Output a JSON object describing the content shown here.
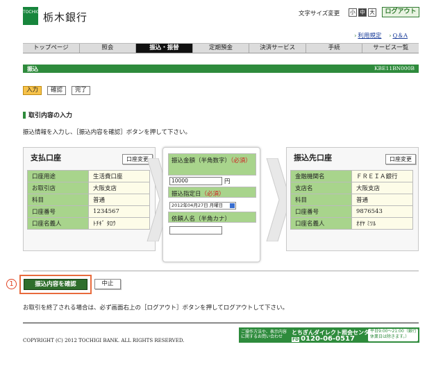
{
  "header": {
    "logo_text": "TOCHIGI",
    "bank_name": "栃木銀行",
    "font_size_label": "文字サイズ変更",
    "font_sizes": [
      "小",
      "中",
      "大"
    ],
    "logout": "ログアウト",
    "links": [
      "利用規定",
      "Q＆A"
    ]
  },
  "nav": [
    "トップページ",
    "照会",
    "振込・振替",
    "定期預金",
    "決済サービス",
    "手続",
    "サービス一覧"
  ],
  "nav_active": 2,
  "title": "振込",
  "title_code": "KBE11BN000B",
  "steps": [
    "入力",
    "確認",
    "完了"
  ],
  "section_title": "取引内容の入力",
  "instruction": "振込情報を入力し、［振込内容を確認］ボタンを押して下さい。",
  "from_account": {
    "title": "支払口座",
    "change_button": "口座変更",
    "rows": [
      {
        "key": "口座用途",
        "value": "生活費口座"
      },
      {
        "key": "お取引店",
        "value": "大阪支店"
      },
      {
        "key": "科目",
        "value": "普通"
      },
      {
        "key": "口座番号",
        "value": "1234567"
      },
      {
        "key": "口座名義人",
        "value": "ﾄﾁｷﾞ ﾀﾛｳ"
      }
    ]
  },
  "transfer_form": {
    "amount_label": "振込金額（半角数字）",
    "required": "（必須）",
    "amount_value": "10000",
    "amount_unit": "円",
    "date_label": "振込指定日",
    "date_value": "2012年04月27日 月曜日",
    "requester_label": "依頼人名（半角カナ）",
    "requester_value": ""
  },
  "to_account": {
    "title": "振込先口座",
    "change_button": "口座変更",
    "rows": [
      {
        "key": "金融機関名",
        "value": "ＦＲＥＩＡ銀行"
      },
      {
        "key": "支店名",
        "value": "大阪支店"
      },
      {
        "key": "科目",
        "value": "普通"
      },
      {
        "key": "口座番号",
        "value": "9876543"
      },
      {
        "key": "口座名義人",
        "value": "ｵｵﾔ ﾐﾂﾙ"
      }
    ]
  },
  "marker": "1",
  "confirm_button": "振込内容を確認",
  "cancel_button": "中止",
  "footer_note": "お取引を終了される場合は、必ず画面右上の［ログアウト］ボタンを押してログアウトして下さい。",
  "copyright": "COPYRIGHT (C) 2012 TOCHIGI BANK. ALL RIGHTS RESERVED.",
  "banner": {
    "left_text": "ご操作方法や、表示内容に関するお問い合わせ",
    "center_name": "とちぎんダイレクト照会センター",
    "free_dial_mark": "FD",
    "phone": "0120-06-0517",
    "hours": "平日9:00〜21:00（銀行休業日は除きます。）"
  },
  "colors": {
    "brand_green": "#2e8b3c",
    "table_key": "#a8d48c",
    "highlight": "#e86a3c",
    "step_active": "#f6c24a"
  }
}
